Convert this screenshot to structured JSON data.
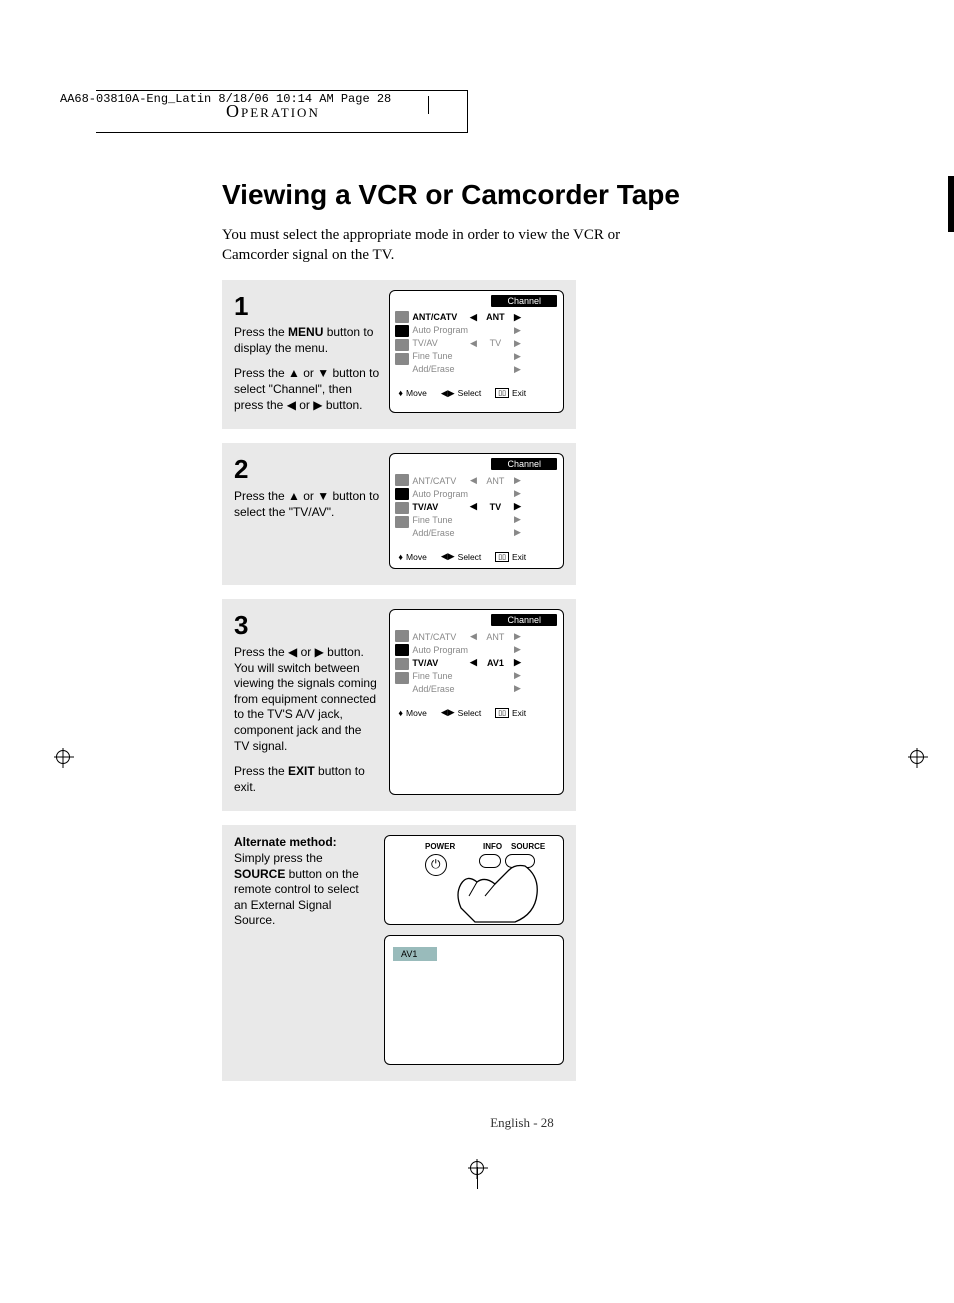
{
  "print_header": "AA68-03810A-Eng_Latin  8/18/06  10:14 AM  Page 28",
  "section_header": "Operation",
  "title": "Viewing a VCR or Camcorder Tape",
  "intro": "You must select the appropriate mode in order to view the VCR or Camcorder signal on the TV.",
  "steps": [
    {
      "num": "1",
      "text_parts": [
        "Press the ",
        "MENU",
        " button to display the menu."
      ],
      "text2_parts": [
        "Press the ▲ or ▼ button to select \"Channel\", then press the ◀ or ▶ button."
      ],
      "osd": {
        "sel_index": 0,
        "tvav_val": "TV"
      }
    },
    {
      "num": "2",
      "text_parts": [
        "Press the ▲ or ▼ button to select the \"TV/AV\"."
      ],
      "osd": {
        "sel_index": 2,
        "tvav_val": "TV"
      }
    },
    {
      "num": "3",
      "text_parts": [
        "Press the ◀ or ▶ button. You will switch between viewing the signals coming from equipment connected to the TV'S A/V jack, component jack and the TV signal."
      ],
      "text2_parts": [
        "Press the ",
        "EXIT",
        " button to exit."
      ],
      "osd": {
        "sel_index": 2,
        "tvav_val": "AV1"
      }
    }
  ],
  "osd_common": {
    "header_badge": "Channel",
    "rows": [
      {
        "label": "ANT/CATV",
        "val": "ANT",
        "arrows": "both"
      },
      {
        "label": "Auto Program",
        "val": "",
        "arrows": "right"
      },
      {
        "label": "TV/AV",
        "val": "",
        "arrows": "both"
      },
      {
        "label": "Fine Tune",
        "val": "",
        "arrows": "right"
      },
      {
        "label": "Add/Erase",
        "val": "",
        "arrows": "right"
      }
    ],
    "footer": {
      "move": "Move",
      "select": "Select",
      "exit": "Exit"
    }
  },
  "alternate": {
    "heading": "Alternate method:",
    "text_parts": [
      "Simply press the ",
      "SOURCE",
      " button on the remote control to select an External Signal Source."
    ]
  },
  "remote_labels": {
    "power": "POWER",
    "info": "INFO",
    "source": "SOURCE"
  },
  "blank_osd_badge": "AV1",
  "page_footer": "English - 28"
}
